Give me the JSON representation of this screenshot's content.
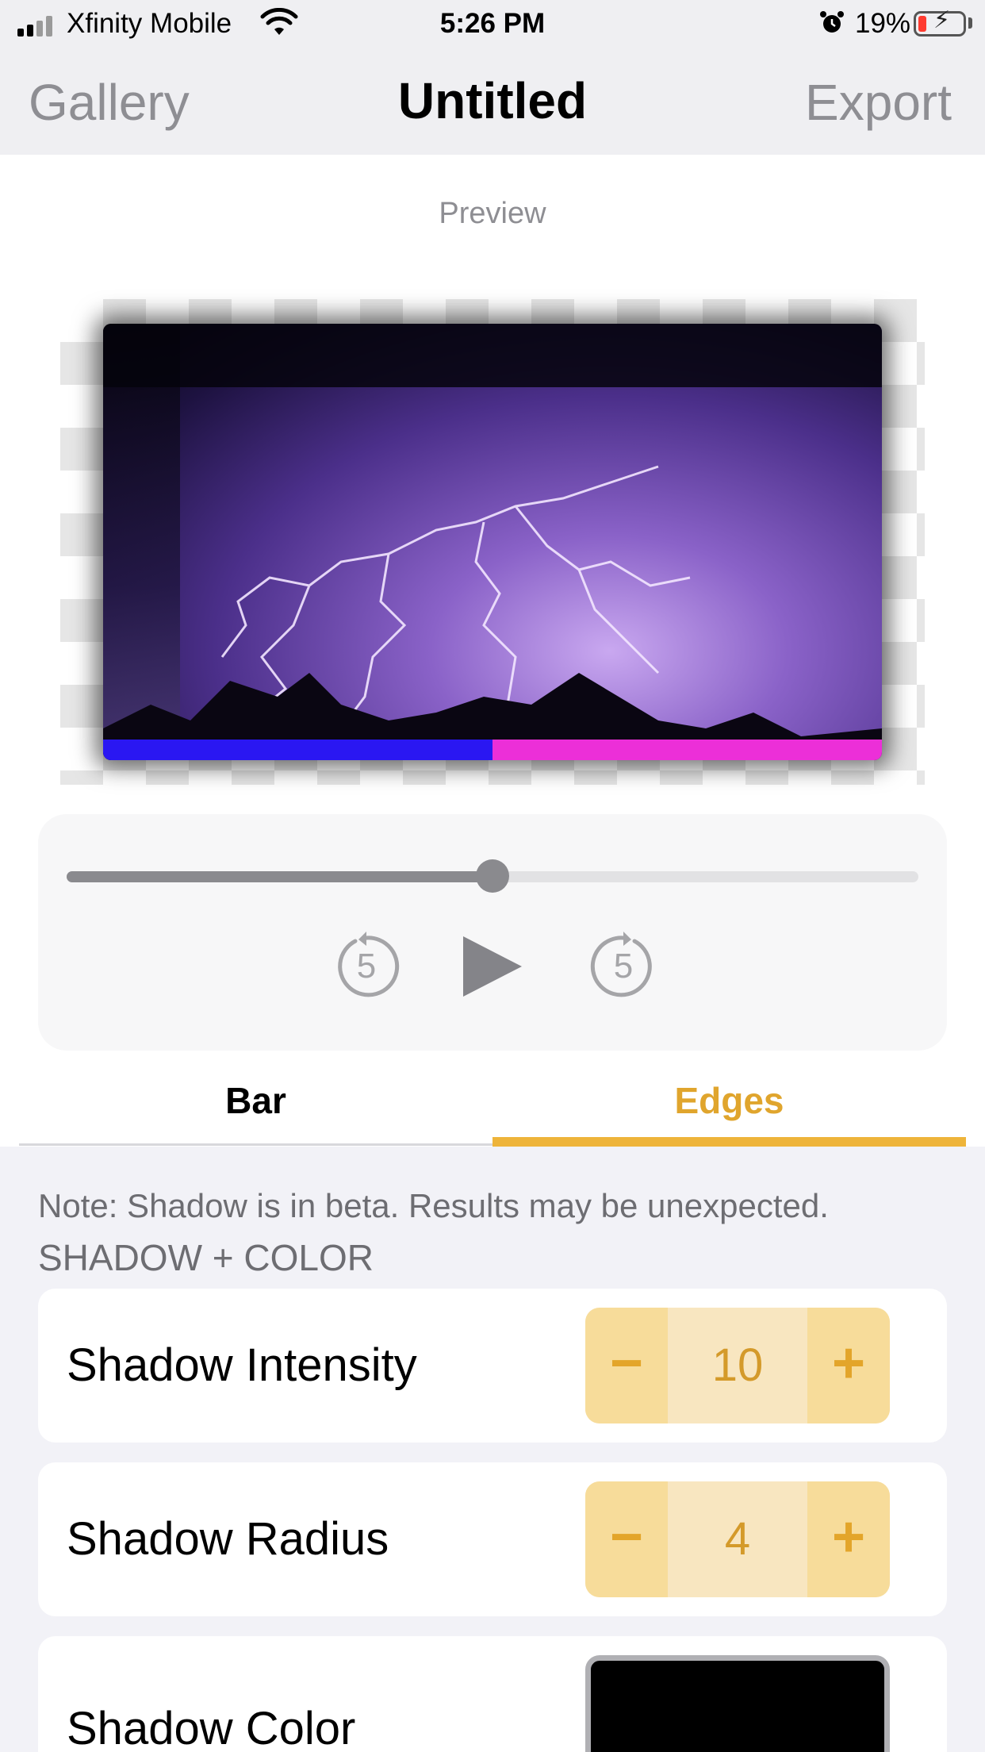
{
  "status_bar": {
    "carrier": "Xfinity Mobile",
    "time": "5:26 PM",
    "battery_percent": "19%",
    "icons": [
      "signal-icon",
      "wifi-icon",
      "alarm-icon",
      "battery-charging-icon"
    ]
  },
  "nav": {
    "left": "Gallery",
    "title": "Untitled",
    "right": "Export"
  },
  "preview": {
    "label": "Preview",
    "progress_bar_fraction": 0.5,
    "progress_colors": {
      "played": "#2a17f2",
      "remaining": "#ec2fd8"
    }
  },
  "player": {
    "slider_fraction": 0.5,
    "skip_back_label": "5",
    "skip_forward_label": "5",
    "icons": [
      "skip-back-5-icon",
      "play-icon",
      "skip-forward-5-icon"
    ]
  },
  "tabs": {
    "items": [
      "Bar",
      "Edges"
    ],
    "selected": "Edges",
    "accent_color": "#eeb43a"
  },
  "settings": {
    "note": "Note: Shadow is in beta. Results may be unexpected.",
    "section_header": "SHADOW + COLOR",
    "shadow_intensity": {
      "label": "Shadow Intensity",
      "value": "10",
      "minus": "−",
      "plus": "+"
    },
    "shadow_radius": {
      "label": "Shadow Radius",
      "value": "4",
      "minus": "−",
      "plus": "+"
    },
    "shadow_color": {
      "label": "Shadow Color",
      "color": "#000000"
    }
  }
}
